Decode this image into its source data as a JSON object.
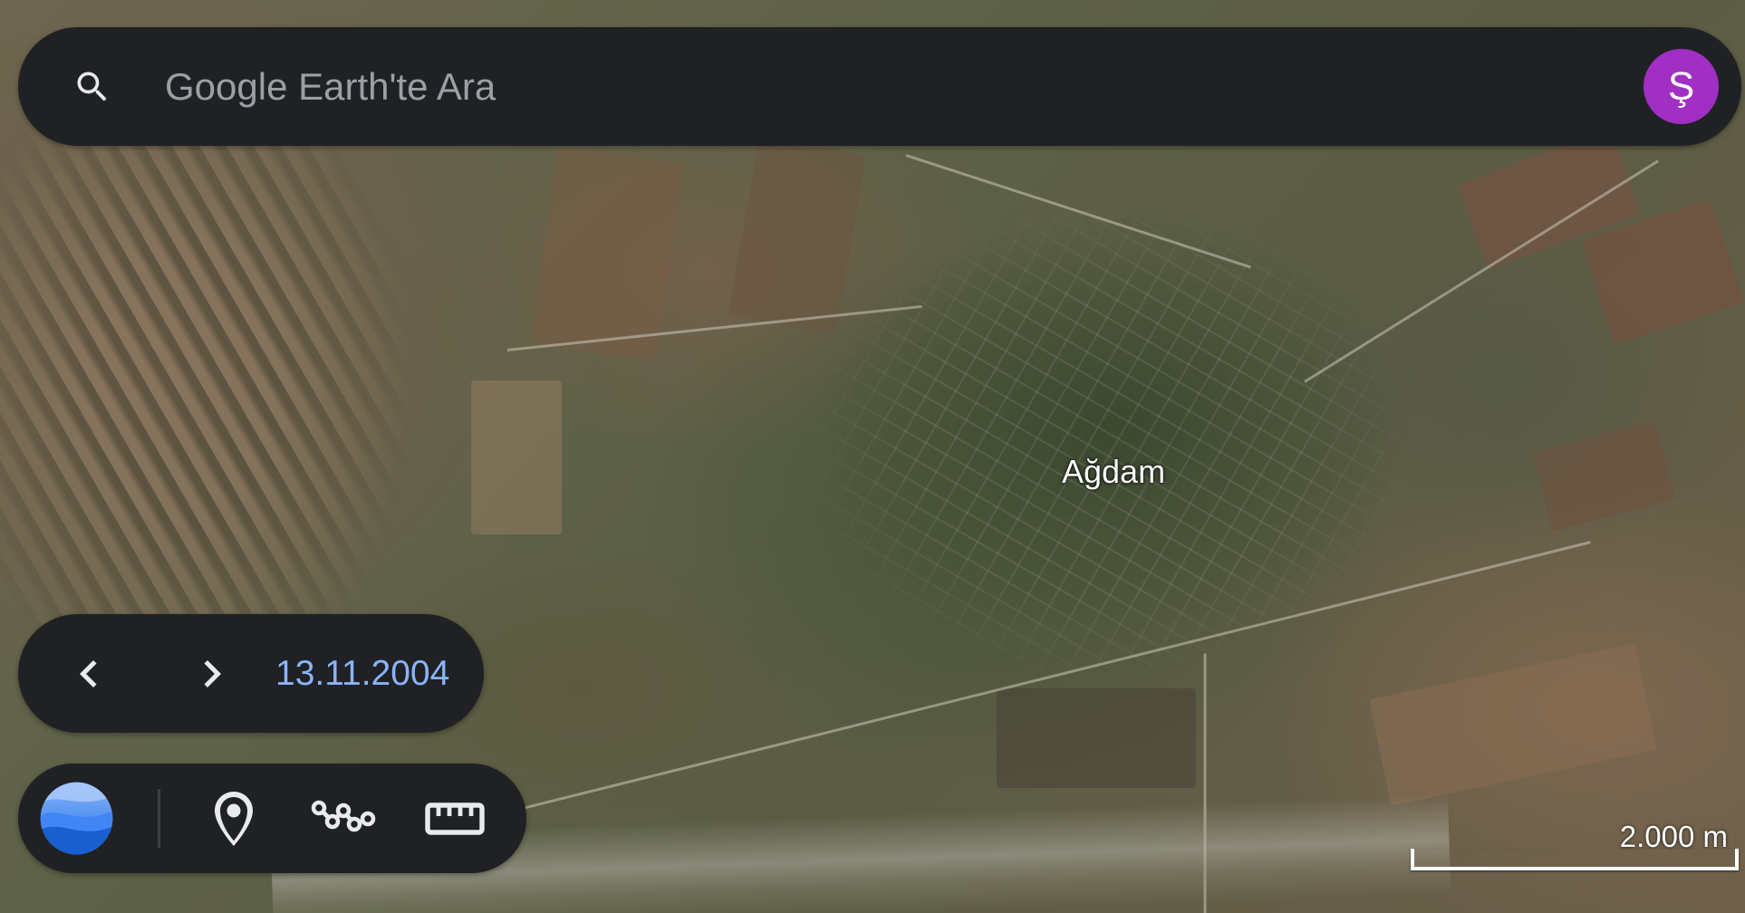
{
  "search": {
    "placeholder": "Google Earth'te Ara",
    "avatar_letter": "Ş",
    "avatar_color": "#a12fc3"
  },
  "map": {
    "place_label": "Ağdam",
    "scale_label": "2.000 m"
  },
  "timeline": {
    "date": "13.11.2004",
    "date_color": "#8ab4f8",
    "prev_icon": "chevron-left-icon",
    "next_icon": "chevron-right-icon"
  },
  "toolbar": {
    "logo_icon": "google-earth-logo-icon",
    "tools": [
      "map-pin-icon",
      "draw-path-icon",
      "ruler-icon"
    ]
  },
  "colors": {
    "panel_bg": "#202124",
    "icon": "#e8eaed",
    "placeholder": "#9aa0a6"
  }
}
